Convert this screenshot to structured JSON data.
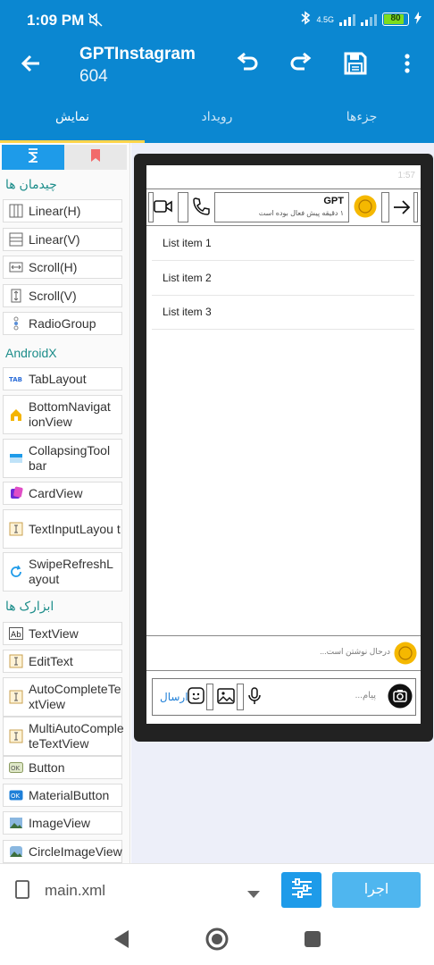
{
  "status": {
    "time": "1:09 PM",
    "network": "4.5G",
    "battery": "80"
  },
  "appbar": {
    "title": "GPTInstagram",
    "subtitle": "604"
  },
  "tabs": [
    "نمایش",
    "رویداد",
    "جزءها"
  ],
  "palette": {
    "section_layouts": "چیدمان ها",
    "layouts": [
      "Linear(H)",
      "Linear(V)",
      "Scroll(H)",
      "Scroll(V)",
      "RadioGroup"
    ],
    "section_androidx": "AndroidX",
    "androidx": [
      "TabLayout",
      "BottomNavigat ionView",
      "CollapsingTool bar",
      "CardView",
      "TextInputLayou t",
      "SwipeRefreshL ayout"
    ],
    "section_tools": "ابزارک ها",
    "tools": [
      "TextView",
      "EditText",
      "AutoCompleteTe xtView",
      "MultiAutoComple teTextView",
      "Button",
      "MaterialButton",
      "ImageView",
      "CircleImageView"
    ]
  },
  "preview": {
    "status_time": "1:57",
    "chat_name": "GPT",
    "chat_status": "۱ دقیقه پیش فعال بوده است",
    "list": [
      "List item 1",
      "List item 2",
      "List item 3"
    ],
    "typing": "درحال نوشتن است...",
    "message_placeholder": "پیام...",
    "send": "ارسال"
  },
  "bottom": {
    "file": "main.xml",
    "run": "اجرا"
  },
  "colors": {
    "primary": "#0b87d1",
    "accent": "#ffd54a",
    "run_button": "#4fb6ef"
  }
}
